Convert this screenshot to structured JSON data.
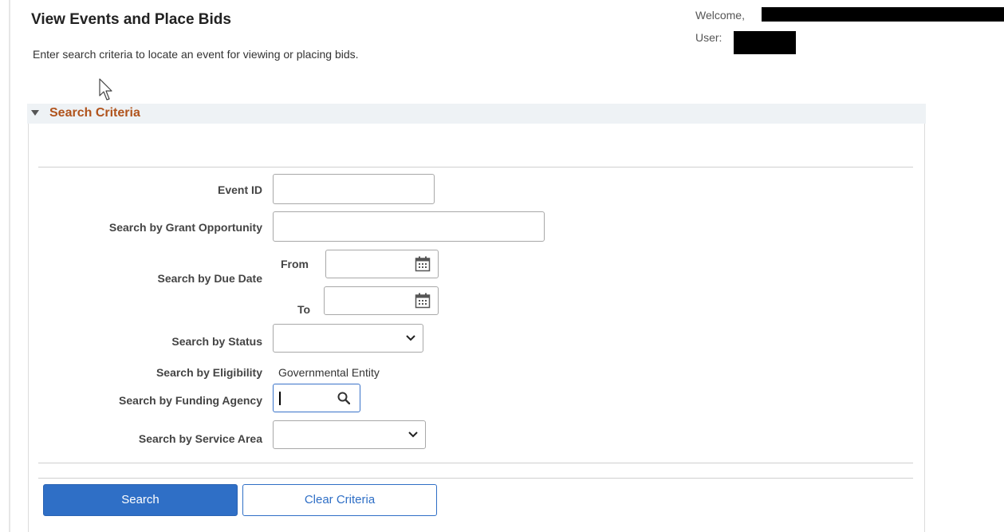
{
  "header": {
    "title": "View Events and Place Bids",
    "instructions": "Enter search criteria to locate an event for viewing or placing bids.",
    "welcome_label": "Welcome,",
    "user_label": "User:"
  },
  "section": {
    "title": "Search Criteria"
  },
  "form": {
    "event_id": {
      "label": "Event ID",
      "value": ""
    },
    "grant_opportunity": {
      "label": "Search by Grant Opportunity",
      "value": ""
    },
    "due_date": {
      "label": "Search by Due Date",
      "from_label": "From",
      "to_label": "To",
      "from_value": "",
      "to_value": ""
    },
    "status": {
      "label": "Search by Status",
      "selected": ""
    },
    "eligibility": {
      "label": "Search by Eligibility",
      "value": "Governmental Entity"
    },
    "funding_agency": {
      "label": "Search by Funding Agency",
      "value": ""
    },
    "service_area": {
      "label": "Search by Service Area",
      "selected": ""
    }
  },
  "buttons": {
    "search_label": "Search",
    "clear_label": "Clear Criteria"
  },
  "colors": {
    "section_title": "#b0531c",
    "primary_button": "#2f6fc6",
    "active_border": "#3a73c9"
  },
  "icons": {
    "collapse": "triangle-down-icon",
    "calendar": "calendar-icon",
    "dropdown": "chevron-down-icon",
    "lookup": "magnifier-search-icon"
  }
}
